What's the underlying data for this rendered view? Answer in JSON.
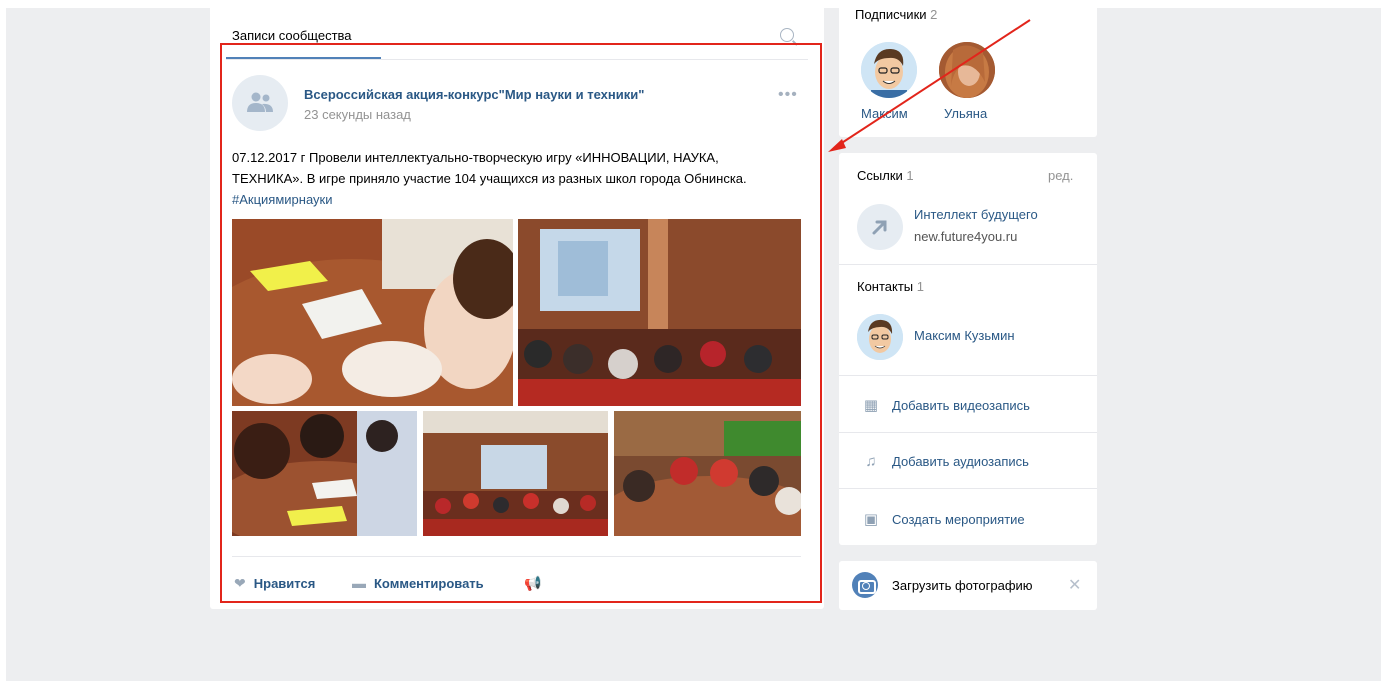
{
  "wall": {
    "tab_label": "Записи сообщества",
    "post": {
      "author": "Всероссийская акция-конкурс\"Мир науки и техники\"",
      "time": "23 секунды назад",
      "text": "07.12.2017 г Провели интеллектуально-творческую игру «ИННОВАЦИИ, НАУКА, ТЕХНИКА». В игре приняло участие 104 учащихся из разных школ города Обнинска.",
      "hashtag": "#Акциямирнауки",
      "actions": {
        "like": "Нравится",
        "comment": "Комментировать"
      }
    }
  },
  "subscribers": {
    "title": "Подписчики",
    "count": "2",
    "people": [
      {
        "name": "Максим"
      },
      {
        "name": "Ульяна"
      }
    ]
  },
  "links": {
    "title": "Ссылки",
    "count": "1",
    "edit": "ред.",
    "items": [
      {
        "title": "Интеллект будущего",
        "url": "new.future4you.ru"
      }
    ]
  },
  "contacts": {
    "title": "Контакты",
    "count": "1",
    "items": [
      {
        "name": "Максим Кузьмин"
      }
    ]
  },
  "menu": {
    "add_video": "Добавить видеозапись",
    "add_audio": "Добавить аудиозапись",
    "create_event": "Создать мероприятие"
  },
  "upload": {
    "label": "Загрузить фотографию"
  },
  "colors": {
    "highlight": "#e2251b",
    "link": "#2a5885",
    "accent": "#5181b8",
    "page_bg": "#edeef0"
  }
}
